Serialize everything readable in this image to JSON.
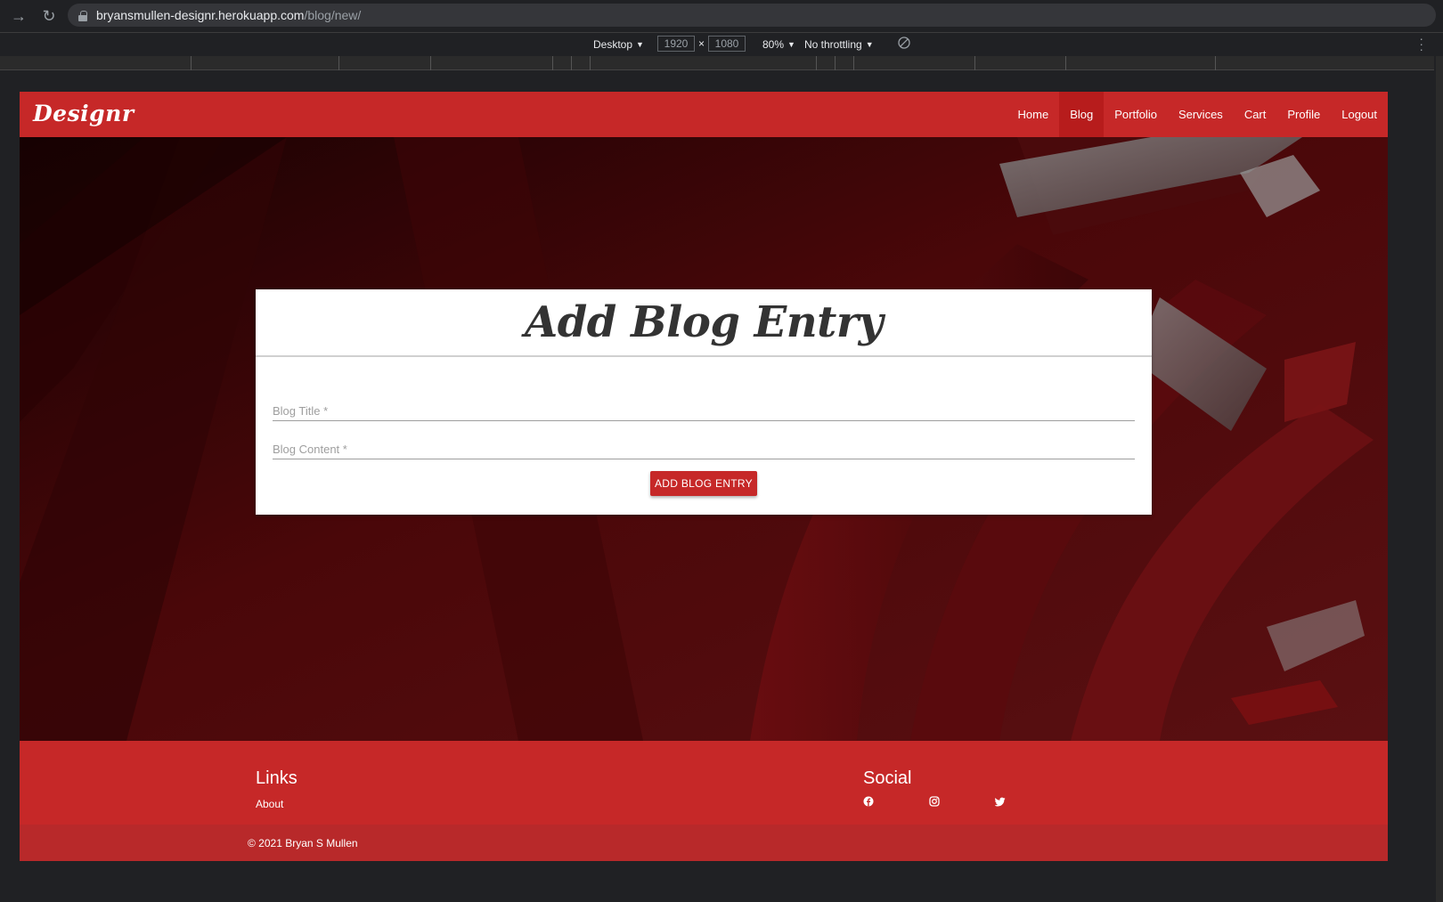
{
  "browser": {
    "url_host": "bryansmullen-designr.herokuapp.com",
    "url_path": "/blog/new/"
  },
  "devtools": {
    "device": "Desktop",
    "width": "1920",
    "height": "1080",
    "times": "×",
    "zoom": "80%",
    "throttling": "No throttling"
  },
  "navbar": {
    "brand": "Designr",
    "links": [
      {
        "label": "Home"
      },
      {
        "label": "Blog",
        "active": true
      },
      {
        "label": "Portfolio"
      },
      {
        "label": "Services"
      },
      {
        "label": "Cart"
      },
      {
        "label": "Profile"
      },
      {
        "label": "Logout"
      }
    ]
  },
  "form": {
    "title": "Add Blog Entry",
    "blog_title_placeholder": "Blog Title *",
    "blog_content_placeholder": "Blog Content *",
    "submit_label": "ADD BLOG ENTRY"
  },
  "footer": {
    "links_heading": "Links",
    "about_link": "About",
    "social_heading": "Social",
    "social_icons": [
      "facebook-icon",
      "instagram-icon",
      "twitter-icon"
    ],
    "copyright": "© 2021 Bryan S Mullen"
  },
  "colors": {
    "brand_red": "#c62828",
    "active_nav": "#b71c1c"
  }
}
